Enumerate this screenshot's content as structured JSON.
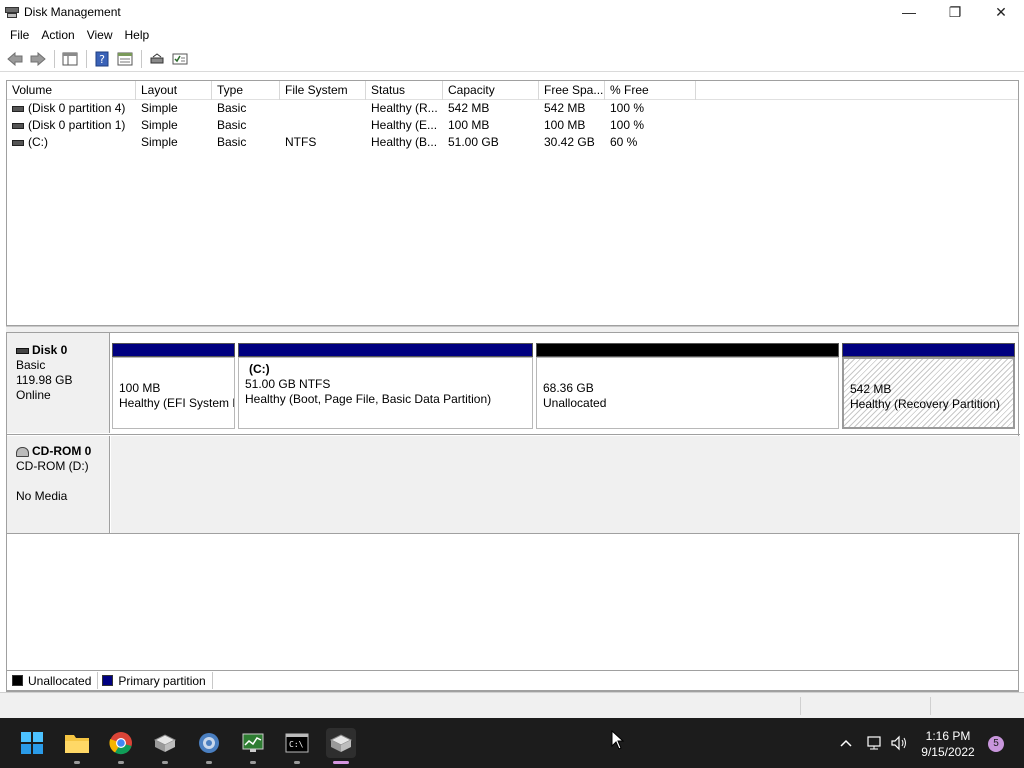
{
  "window": {
    "title": "Disk Management",
    "minimize_glyph": "—",
    "maximize_glyph": "❐",
    "close_glyph": "✕"
  },
  "menu": [
    "File",
    "Action",
    "View",
    "Help"
  ],
  "toolbar_icons": [
    "back-arrow-icon",
    "forward-arrow-icon",
    "console-tree-icon",
    "help-icon",
    "properties-icon",
    "rescan-disks-icon",
    "disk-list-icon"
  ],
  "volume_list": {
    "columns": [
      "Volume",
      "Layout",
      "Type",
      "File System",
      "Status",
      "Capacity",
      "Free Spa...",
      "% Free"
    ],
    "rows": [
      [
        "(Disk 0 partition 4)",
        "Simple",
        "Basic",
        "",
        "Healthy (R...",
        "542 MB",
        "542 MB",
        "100 %"
      ],
      [
        "(Disk 0 partition 1)",
        "Simple",
        "Basic",
        "",
        "Healthy (E...",
        "100 MB",
        "100 MB",
        "100 %"
      ],
      [
        "(C:)",
        "Simple",
        "Basic",
        "NTFS",
        "Healthy (B...",
        "51.00 GB",
        "30.42 GB",
        "60 %"
      ]
    ]
  },
  "disk0": {
    "name": "Disk 0",
    "type": "Basic",
    "size": "119.98 GB",
    "state": "Online",
    "partitions": [
      {
        "title": "",
        "size": "100 MB",
        "status": "Healthy (EFI System P",
        "kind": "primary"
      },
      {
        "title": "(C:)",
        "size": "51.00 GB NTFS",
        "status": "Healthy (Boot, Page File, Basic Data Partition)",
        "kind": "primary"
      },
      {
        "title": "",
        "size": "68.36 GB",
        "status": "Unallocated",
        "kind": "unallocated"
      },
      {
        "title": "",
        "size": "542 MB",
        "status": "Healthy (Recovery Partition)",
        "kind": "primary"
      }
    ]
  },
  "cdrom0": {
    "name": "CD-ROM 0",
    "drive": "CD-ROM (D:)",
    "media": "No Media"
  },
  "legend": [
    {
      "label": "Unallocated",
      "color": "#000000"
    },
    {
      "label": "Primary partition",
      "color": "#000080"
    }
  ],
  "taskbar": {
    "time": "1:16 PM",
    "date": "9/15/2022",
    "notifications": "5"
  },
  "colors": {
    "primary": "#000080",
    "unallocated": "#000000"
  }
}
